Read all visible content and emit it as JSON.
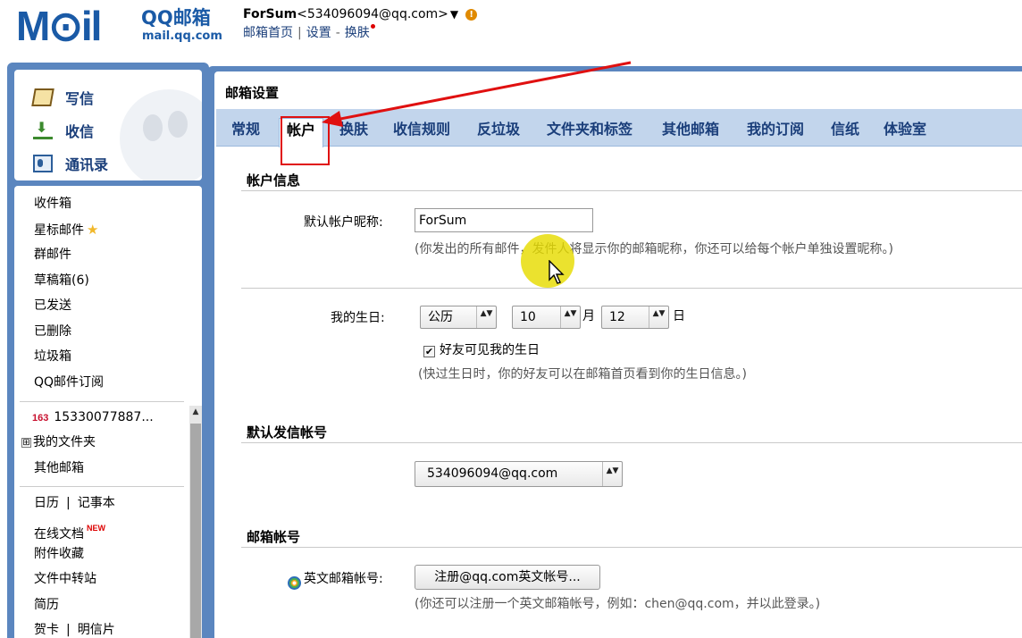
{
  "header": {
    "logo_text": "M⊙il",
    "logo_brand": "QQ邮箱",
    "logo_domain": "mail.qq.com",
    "account_name": "ForSum",
    "account_email": "<534096094@qq.com>",
    "account_dropdown": "▼",
    "warn_icon": "!",
    "links": [
      "邮箱首页",
      "设置",
      "换肤"
    ],
    "link_sep_1": "|",
    "link_sep_2": "-"
  },
  "sidebar": {
    "actions": [
      {
        "label": "写信",
        "icon": "write-icon"
      },
      {
        "label": "收信",
        "icon": "inbox-icon"
      },
      {
        "label": "通讯录",
        "icon": "contacts-icon"
      }
    ],
    "folders": [
      "收件箱",
      "星标邮件",
      "群邮件",
      "草稿箱(6)",
      "已发送",
      "已删除",
      "垃圾箱",
      "QQ邮件订阅"
    ],
    "star_icon": "★",
    "external_account": "15330077887...",
    "external_icon": "163",
    "my_folders": "我的文件夹",
    "expand_icon": "⊞",
    "other_mailbox": "其他邮箱",
    "calendar": "日历",
    "notes": "记事本",
    "online_docs": "在线文档",
    "new_badge": "NEW",
    "attachments": "附件收藏",
    "file_transfer": "文件中转站",
    "resume": "简历",
    "greeting_card": "贺卡",
    "postcard": "明信片",
    "sep": "|"
  },
  "main": {
    "title": "邮箱设置",
    "tabs": [
      "常规",
      "帐户",
      "换肤",
      "收信规则",
      "反垃圾",
      "文件夹和标签",
      "其他邮箱",
      "我的订阅",
      "信纸",
      "体验室"
    ],
    "active_tab": "帐户",
    "account_info": {
      "section_title": "帐户信息",
      "nickname_label": "默认帐户昵称:",
      "nickname_value": "ForSum",
      "nickname_hint": "(你发出的所有邮件，发件人将显示你的邮箱昵称，你还可以给每个帐户单独设置昵称。)",
      "birthday_label": "我的生日:",
      "calendar_type": "公历",
      "month": "10",
      "month_unit": "月",
      "day": "12",
      "day_unit": "日",
      "birthday_visible_label": "好友可见我的生日",
      "birthday_visible": true,
      "check_mark": "✔",
      "birthday_hint": "(快过生日时，你的好友可以在邮箱首页看到你的生日信息。)"
    },
    "default_sender": {
      "section_title": "默认发信帐号",
      "value": "534096094@qq.com"
    },
    "mailbox_account": {
      "section_title": "邮箱帐号",
      "english_label": "英文邮箱帐号:",
      "register_button": "注册@qq.com英文帐号...",
      "hint": "(你还可以注册一个英文邮箱帐号，例如：chen@qq.com，并以此登录。)"
    },
    "select_arrows": "▲▼"
  },
  "colors": {
    "frame_blue": "#5b86bf",
    "tab_bar": "#c2d5ec",
    "link_blue": "#1a3e7a",
    "annotation_red": "#e01010",
    "cursor_halo": "#e6dc00"
  }
}
